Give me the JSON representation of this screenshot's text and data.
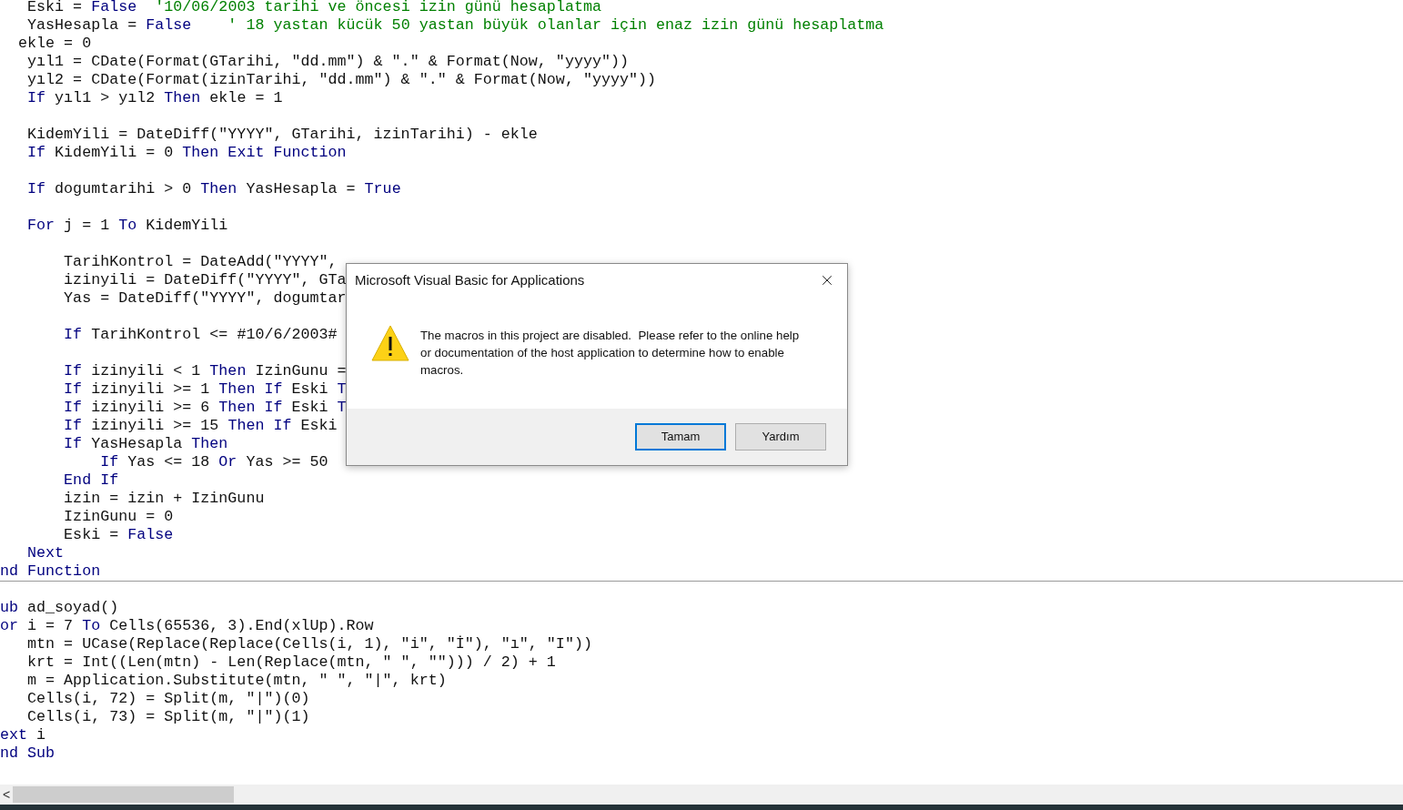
{
  "code_editor": {
    "lines": [
      {
        "kind": "code",
        "segments": [
          {
            "t": "   Eski = ",
            "kind": "plain"
          },
          {
            "t": "False",
            "kind": "keyword"
          },
          {
            "t": "  '10/06/2003 tarihi ve öncesi izin günü hesaplatma",
            "kind": "comment"
          }
        ]
      },
      {
        "kind": "code",
        "segments": [
          {
            "t": "   YasHesapla = ",
            "kind": "plain"
          },
          {
            "t": "False",
            "kind": "keyword"
          },
          {
            "t": "    ' 18 yastan kücük 50 yastan büyük olanlar için enaz izin günü hesaplatma",
            "kind": "comment"
          }
        ]
      },
      {
        "kind": "code",
        "segments": [
          {
            "t": "  ekle = 0",
            "kind": "plain"
          }
        ]
      },
      {
        "kind": "code",
        "segments": [
          {
            "t": "   yıl1 = CDate(Format(GTarihi, \"dd.mm\") & \".\" & Format(Now, \"yyyy\"))",
            "kind": "plain"
          }
        ]
      },
      {
        "kind": "code",
        "segments": [
          {
            "t": "   yıl2 = CDate(Format(izinTarihi, \"dd.mm\") & \".\" & Format(Now, \"yyyy\"))",
            "kind": "plain"
          }
        ]
      },
      {
        "kind": "code",
        "segments": [
          {
            "t": "   If",
            "kind": "keyword"
          },
          {
            "t": " yıl1 > yıl2 ",
            "kind": "plain"
          },
          {
            "t": "Then",
            "kind": "keyword"
          },
          {
            "t": " ekle = 1",
            "kind": "plain"
          }
        ]
      },
      {
        "kind": "blank"
      },
      {
        "kind": "code",
        "segments": [
          {
            "t": "   KidemYili = DateDiff(\"YYYY\", GTarihi, izinTarihi) - ekle",
            "kind": "plain"
          }
        ]
      },
      {
        "kind": "code",
        "segments": [
          {
            "t": "   If",
            "kind": "keyword"
          },
          {
            "t": " KidemYili = 0 ",
            "kind": "plain"
          },
          {
            "t": "Then Exit Function",
            "kind": "keyword"
          }
        ]
      },
      {
        "kind": "blank"
      },
      {
        "kind": "code",
        "segments": [
          {
            "t": "   If",
            "kind": "keyword"
          },
          {
            "t": " dogumtarihi > 0 ",
            "kind": "plain"
          },
          {
            "t": "Then",
            "kind": "keyword"
          },
          {
            "t": " YasHesapla = ",
            "kind": "plain"
          },
          {
            "t": "True",
            "kind": "keyword"
          }
        ]
      },
      {
        "kind": "blank"
      },
      {
        "kind": "code",
        "segments": [
          {
            "t": "   For",
            "kind": "keyword"
          },
          {
            "t": " j = 1 ",
            "kind": "plain"
          },
          {
            "t": "To",
            "kind": "keyword"
          },
          {
            "t": " KidemYili",
            "kind": "plain"
          }
        ]
      },
      {
        "kind": "blank"
      },
      {
        "kind": "code",
        "segments": [
          {
            "t": "       TarihKontrol = DateAdd(\"YYYY\",",
            "kind": "plain"
          }
        ]
      },
      {
        "kind": "code",
        "segments": [
          {
            "t": "       izinyili = DateDiff(\"YYYY\", GTa",
            "kind": "plain"
          }
        ]
      },
      {
        "kind": "code",
        "segments": [
          {
            "t": "       Yas = DateDiff(\"YYYY\", dogumtar",
            "kind": "plain"
          }
        ]
      },
      {
        "kind": "blank"
      },
      {
        "kind": "code",
        "segments": [
          {
            "t": "       If",
            "kind": "keyword"
          },
          {
            "t": " TarihKontrol <= #10/6/2003#",
            "kind": "plain"
          }
        ]
      },
      {
        "kind": "blank"
      },
      {
        "kind": "code",
        "segments": [
          {
            "t": "       If",
            "kind": "keyword"
          },
          {
            "t": " izinyili < 1 ",
            "kind": "plain"
          },
          {
            "t": "Then",
            "kind": "keyword"
          },
          {
            "t": " IzinGunu =",
            "kind": "plain"
          }
        ]
      },
      {
        "kind": "code",
        "segments": [
          {
            "t": "       If",
            "kind": "keyword"
          },
          {
            "t": " izinyili >= 1 ",
            "kind": "plain"
          },
          {
            "t": "Then If",
            "kind": "keyword"
          },
          {
            "t": " Eski ",
            "kind": "plain"
          },
          {
            "t": "T",
            "kind": "keyword"
          }
        ]
      },
      {
        "kind": "code",
        "segments": [
          {
            "t": "       If",
            "kind": "keyword"
          },
          {
            "t": " izinyili >= 6 ",
            "kind": "plain"
          },
          {
            "t": "Then If",
            "kind": "keyword"
          },
          {
            "t": " Eski ",
            "kind": "plain"
          },
          {
            "t": "T",
            "kind": "keyword"
          }
        ]
      },
      {
        "kind": "code",
        "segments": [
          {
            "t": "       If",
            "kind": "keyword"
          },
          {
            "t": " izinyili >= 15 ",
            "kind": "plain"
          },
          {
            "t": "Then If",
            "kind": "keyword"
          },
          {
            "t": " Eski",
            "kind": "plain"
          }
        ]
      },
      {
        "kind": "code",
        "segments": [
          {
            "t": "       If",
            "kind": "keyword"
          },
          {
            "t": " YasHesapla ",
            "kind": "plain"
          },
          {
            "t": "Then",
            "kind": "keyword"
          }
        ]
      },
      {
        "kind": "code",
        "segments": [
          {
            "t": "           If",
            "kind": "keyword"
          },
          {
            "t": " Yas <= 18 ",
            "kind": "plain"
          },
          {
            "t": "Or",
            "kind": "keyword"
          },
          {
            "t": " Yas >= 50",
            "kind": "plain"
          }
        ]
      },
      {
        "kind": "code",
        "segments": [
          {
            "t": "       End If",
            "kind": "keyword"
          }
        ]
      },
      {
        "kind": "code",
        "segments": [
          {
            "t": "       izin = izin + IzinGunu",
            "kind": "plain"
          }
        ]
      },
      {
        "kind": "code",
        "segments": [
          {
            "t": "       IzinGunu = 0",
            "kind": "plain"
          }
        ]
      },
      {
        "kind": "code",
        "segments": [
          {
            "t": "       Eski = ",
            "kind": "plain"
          },
          {
            "t": "False",
            "kind": "keyword"
          }
        ]
      },
      {
        "kind": "code",
        "segments": [
          {
            "t": "   Next",
            "kind": "keyword"
          }
        ]
      },
      {
        "kind": "code",
        "segments": [
          {
            "t": "nd Function",
            "kind": "keyword"
          }
        ]
      },
      {
        "kind": "separator"
      },
      {
        "kind": "blank"
      },
      {
        "kind": "code",
        "segments": [
          {
            "t": "ub",
            "kind": "keyword"
          },
          {
            "t": " ad_soyad()",
            "kind": "plain"
          }
        ]
      },
      {
        "kind": "code",
        "segments": [
          {
            "t": "or",
            "kind": "keyword"
          },
          {
            "t": " i = 7 ",
            "kind": "plain"
          },
          {
            "t": "To",
            "kind": "keyword"
          },
          {
            "t": " Cells(65536, 3).End(xlUp).Row",
            "kind": "plain"
          }
        ]
      },
      {
        "kind": "code",
        "segments": [
          {
            "t": "   mtn = UCase(Replace(Replace(Cells(i, 1), \"i\", \"İ\"), \"ı\", \"I\"))",
            "kind": "plain"
          }
        ]
      },
      {
        "kind": "code",
        "segments": [
          {
            "t": "   krt = Int((Len(mtn) - Len(Replace(mtn, \" \", \"\"))) / 2) + 1",
            "kind": "plain"
          }
        ]
      },
      {
        "kind": "code",
        "segments": [
          {
            "t": "   m = Application.Substitute(mtn, \" \", \"|\", krt)",
            "kind": "plain"
          }
        ]
      },
      {
        "kind": "code",
        "segments": [
          {
            "t": "   Cells(i, 72) = Split(m, \"|\")(0)",
            "kind": "plain"
          }
        ]
      },
      {
        "kind": "code",
        "segments": [
          {
            "t": "   Cells(i, 73) = Split(m, \"|\")(1)",
            "kind": "plain"
          }
        ]
      },
      {
        "kind": "code",
        "segments": [
          {
            "t": "ext",
            "kind": "keyword"
          },
          {
            "t": " i",
            "kind": "plain"
          }
        ]
      },
      {
        "kind": "code",
        "segments": [
          {
            "t": "nd Sub",
            "kind": "keyword"
          }
        ]
      }
    ]
  },
  "scrollbar": {
    "arrow": "<"
  },
  "dialog": {
    "title": "Microsoft Visual Basic for Applications",
    "message": "The macros in this project are disabled.  Please refer to the online help or documentation of the host application to determine how to enable macros.",
    "buttons": [
      {
        "label": "Tamam",
        "default": true
      },
      {
        "label": "Yardım",
        "default": false
      }
    ]
  }
}
